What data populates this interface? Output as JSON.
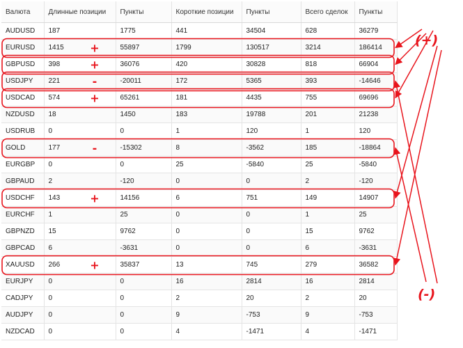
{
  "table": {
    "headers": [
      "Валюта",
      "Длинные позиции",
      "Пункты",
      "Короткие позиции",
      "Пункты",
      "Всего сделок",
      "Пункты"
    ],
    "rows": [
      [
        "AUDUSD",
        "187",
        "1775",
        "441",
        "34504",
        "628",
        "36279"
      ],
      [
        "EURUSD",
        "1415",
        "55897",
        "1799",
        "130517",
        "3214",
        "186414"
      ],
      [
        "GBPUSD",
        "398",
        "36076",
        "420",
        "30828",
        "818",
        "66904"
      ],
      [
        "USDJPY",
        "221",
        "-20011",
        "172",
        "5365",
        "393",
        "-14646"
      ],
      [
        "USDCAD",
        "574",
        "65261",
        "181",
        "4435",
        "755",
        "69696"
      ],
      [
        "NZDUSD",
        "18",
        "1450",
        "183",
        "19788",
        "201",
        "21238"
      ],
      [
        "USDRUB",
        "0",
        "0",
        "1",
        "120",
        "1",
        "120"
      ],
      [
        "GOLD",
        "177",
        "-15302",
        "8",
        "-3562",
        "185",
        "-18864"
      ],
      [
        "EURGBP",
        "0",
        "0",
        "25",
        "-5840",
        "25",
        "-5840"
      ],
      [
        "GBPAUD",
        "2",
        "-120",
        "0",
        "0",
        "2",
        "-120"
      ],
      [
        "USDCHF",
        "143",
        "14156",
        "6",
        "751",
        "149",
        "14907"
      ],
      [
        "EURCHF",
        "1",
        "25",
        "0",
        "0",
        "1",
        "25"
      ],
      [
        "GBPNZD",
        "15",
        "9762",
        "0",
        "0",
        "15",
        "9762"
      ],
      [
        "GBPCAD",
        "6",
        "-3631",
        "0",
        "0",
        "6",
        "-3631"
      ],
      [
        "XAUUSD",
        "266",
        "35837",
        "13",
        "745",
        "279",
        "36582"
      ],
      [
        "EURJPY",
        "0",
        "0",
        "16",
        "2814",
        "16",
        "2814"
      ],
      [
        "CADJPY",
        "0",
        "0",
        "2",
        "20",
        "2",
        "20"
      ],
      [
        "AUDJPY",
        "0",
        "0",
        "9",
        "-753",
        "9",
        "-753"
      ],
      [
        "NZDCAD",
        "0",
        "0",
        "4",
        "-1471",
        "4",
        "-1471"
      ]
    ]
  },
  "annotations": {
    "plus_label": "(+)",
    "minus_label": "(-)",
    "plus_sign": "+",
    "minus_sign": "-",
    "plus_rows": [
      "EURUSD",
      "GBPUSD",
      "USDCAD",
      "USDCHF",
      "XAUUSD"
    ],
    "minus_rows": [
      "USDJPY",
      "GOLD"
    ],
    "color": "#e8141c"
  }
}
